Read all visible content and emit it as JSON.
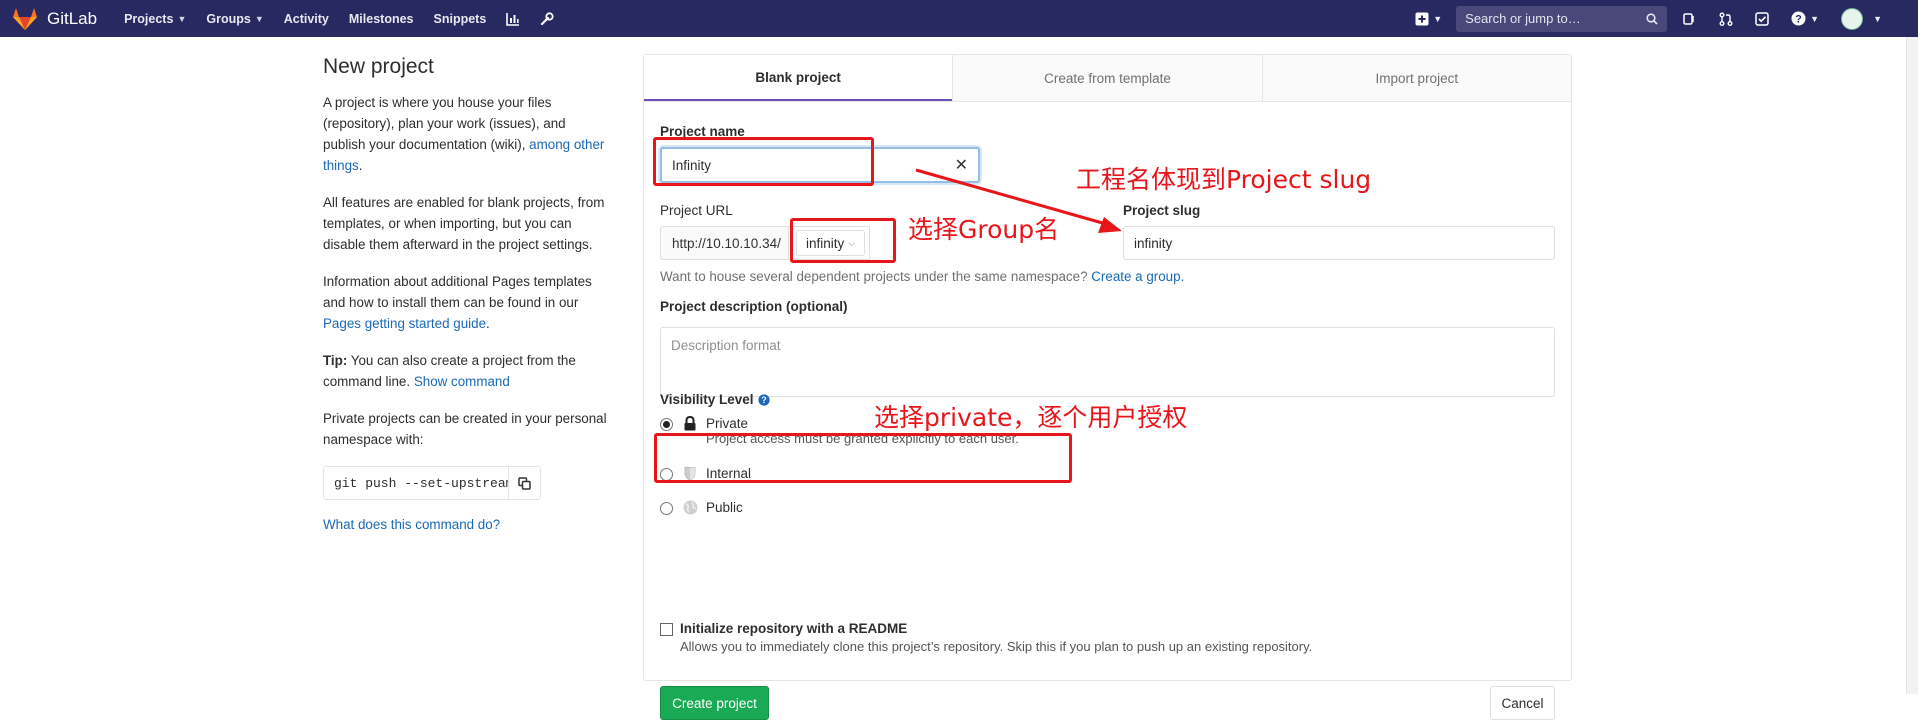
{
  "navbar": {
    "brand": "GitLab",
    "items": [
      {
        "label": "Projects",
        "dropdown": true
      },
      {
        "label": "Groups",
        "dropdown": true
      },
      {
        "label": "Activity",
        "dropdown": false
      },
      {
        "label": "Milestones",
        "dropdown": false
      },
      {
        "label": "Snippets",
        "dropdown": false
      }
    ],
    "search_placeholder": "Search or jump to…"
  },
  "sidebar": {
    "title": "New project",
    "p1_text": "A project is where you house your files (repository), plan your work (issues), and publish your documentation (wiki), ",
    "p1_link": "among other things",
    "p1_end": ".",
    "p2": "All features are enabled for blank projects, from templates, or when importing, but you can disable them afterward in the project settings.",
    "p3_text": "Information about additional Pages templates and how to install them can be found in our ",
    "p3_link": "Pages getting started guide",
    "p3_end": ".",
    "tip_label": "Tip:",
    "tip_text": " You can also create a project from the command line. ",
    "tip_link": "Show command",
    "p5": "Private projects can be created in your personal namespace with:",
    "command": "git push --set-upstream",
    "command_help": "What does this command do?"
  },
  "tabs": [
    "Blank project",
    "Create from template",
    "Import project"
  ],
  "form": {
    "name_label": "Project name",
    "name_value": "Infinity",
    "url_label": "Project URL",
    "url_prefix": "http://10.10.10.34/",
    "namespace": "infinity",
    "slug_label": "Project slug",
    "slug_value": "infinity",
    "help_text": "Want to house several dependent projects under the same namespace? ",
    "help_link": "Create a group.",
    "desc_label": "Project description (optional)",
    "desc_placeholder": "Description format",
    "visibility_label": "Visibility Level",
    "visibility": [
      {
        "label": "Private",
        "desc": "Project access must be granted explicitly to each user.",
        "selected": true,
        "icon": "lock-icon"
      },
      {
        "label": "Internal",
        "desc": "",
        "selected": false,
        "icon": "shield-icon"
      },
      {
        "label": "Public",
        "desc": "",
        "selected": false,
        "icon": "globe-icon"
      }
    ],
    "readme_label": "Initialize repository with a README",
    "readme_desc": "Allows you to immediately clone this project’s repository. Skip this if you plan to push up an existing repository.",
    "create_button": "Create project",
    "cancel_button": "Cancel"
  },
  "annotations": {
    "slug_note": "工程名体现到Project slug",
    "group_note": "选择Group名",
    "private_note": "选择private，逐个用户授权"
  },
  "colors": {
    "navbar": "#292961",
    "accent": "#6b4fbb",
    "link": "#1b69b6",
    "create": "#1aaa55",
    "annotation": "#e8151b"
  }
}
